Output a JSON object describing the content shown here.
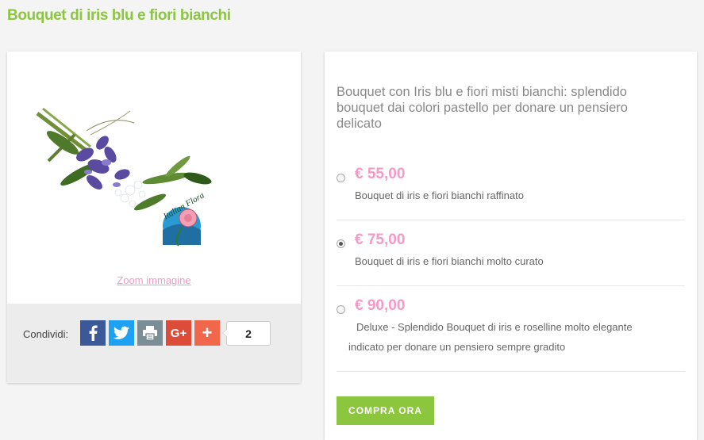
{
  "product": {
    "title": "Bouquet di iris blu e fiori bianchi",
    "description": "Bouquet con Iris blu e fiori misti bianchi: splendido bouquet dai colori pastello per donare un pensiero delicato",
    "zoom_label": "Zoom immagine",
    "logo_text": "Italian Flora"
  },
  "share": {
    "label": "Condividi:",
    "count": "2",
    "buttons": [
      "facebook-icon",
      "twitter-icon",
      "print-icon",
      "google-plus-icon",
      "plus-icon"
    ]
  },
  "options": [
    {
      "price": "€ 55,00",
      "label": "Bouquet di iris e fiori bianchi raffinato",
      "selected": false
    },
    {
      "price": "€ 75,00",
      "label": "Bouquet di iris e fiori bianchi molto curato",
      "selected": true
    },
    {
      "price": "€ 90,00",
      "label": "Deluxe - Splendido Bouquet di iris e roselline molto elegante",
      "label2": "indicato per donare un pensiero sempre gradito",
      "selected": false
    }
  ],
  "buy_label": "COMPRA ORA",
  "colors": {
    "accent": "#8cc63f",
    "price": "#f49ac8",
    "facebook": "#3b5998",
    "twitter": "#1da1f2",
    "print": "#7b8d95",
    "google_plus": "#dd4b39",
    "plus": "#f0674c"
  }
}
